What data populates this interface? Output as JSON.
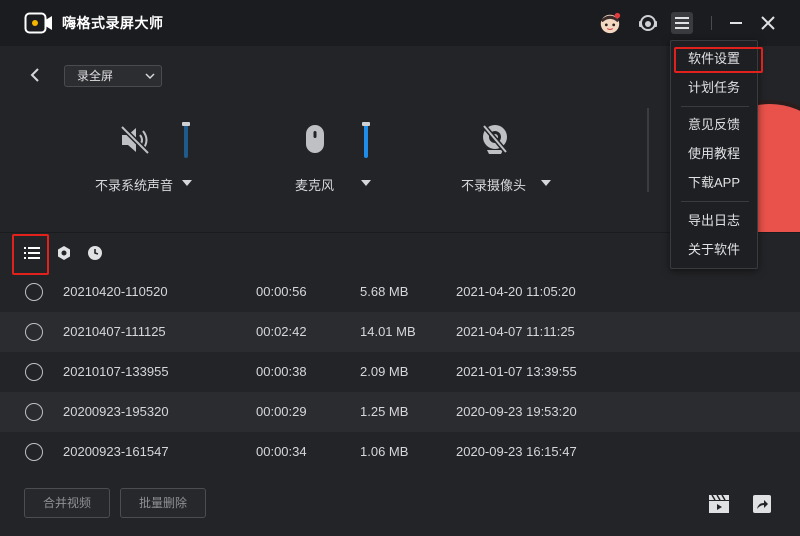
{
  "app": {
    "title": "嗨格式录屏大师"
  },
  "record": {
    "mode": "录全屏",
    "audio": {
      "label": "不录系统声音"
    },
    "mic": {
      "label": "麦克风"
    },
    "camera": {
      "label": "不录摄像头"
    }
  },
  "files": [
    {
      "name": "20210420-110520",
      "duration": "00:00:56",
      "size": "5.68 MB",
      "date": "2021-04-20 11:05:20"
    },
    {
      "name": "20210407-111125",
      "duration": "00:02:42",
      "size": "14.01 MB",
      "date": "2021-04-07 11:11:25"
    },
    {
      "name": "20210107-133955",
      "duration": "00:00:38",
      "size": "2.09 MB",
      "date": "2021-01-07 13:39:55"
    },
    {
      "name": "20200923-195320",
      "duration": "00:00:29",
      "size": "1.25 MB",
      "date": "2020-09-23 19:53:20"
    },
    {
      "name": "20200923-161547",
      "duration": "00:00:34",
      "size": "1.06 MB",
      "date": "2020-09-23 16:15:47"
    }
  ],
  "actions": {
    "merge": "合并视频",
    "batch_delete": "批量删除"
  },
  "menu": {
    "items": [
      "软件设置",
      "计划任务",
      "意见反馈",
      "使用教程",
      "下载APP",
      "导出日志",
      "关于软件"
    ]
  },
  "colors": {
    "accent": "#1e8ce8",
    "record": "#e8524a",
    "highlight": "#e2211c"
  }
}
